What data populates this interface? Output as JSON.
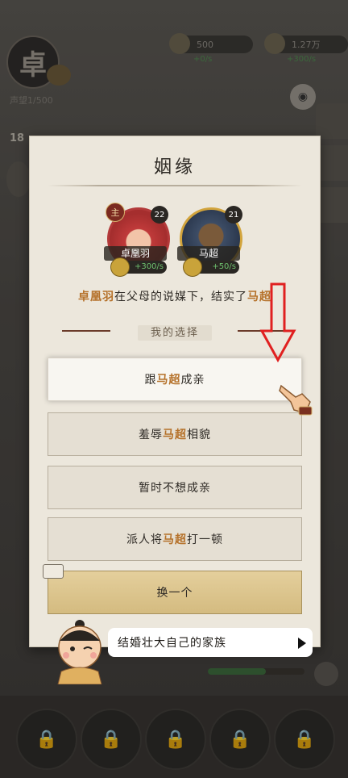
{
  "hud": {
    "player_char": "卓",
    "reputation": "声望1/500",
    "copper": "500",
    "copper_rate": "+0/s",
    "silver": "1.27万",
    "silver_rate": "+300/s",
    "level_num": "18"
  },
  "modal": {
    "title": "姻缘",
    "heroes": [
      {
        "name": "卓凰羽",
        "level": "22",
        "bonus": "+300/s",
        "tag": "主"
      },
      {
        "name": "马超",
        "level": "21",
        "bonus": "+50/s"
      }
    ],
    "story": {
      "a": "卓凰羽",
      "b": "在父母的说媒下，结实了",
      "c": "马超"
    },
    "section_label": "我的选择",
    "choices": [
      {
        "pre": "跟",
        "hl": "马超",
        "post": "成亲"
      },
      {
        "pre": "羞辱",
        "hl": "马超",
        "post": "相貌"
      },
      {
        "pre": "暂时不想成亲",
        "hl": "",
        "post": ""
      },
      {
        "pre": "派人将",
        "hl": "马超",
        "post": "打一顿"
      }
    ],
    "swap_label": "换一个"
  },
  "advisor": {
    "tip": "结婚壮大自己的家族"
  },
  "colors": {
    "highlight": "#b5712a",
    "arrow": "#e02020",
    "swap_bg": "#d9c288"
  },
  "icons": [
    "eye-icon",
    "video-icon",
    "play-icon",
    "lock-icon",
    "down-arrow-icon",
    "pointing-hand-icon",
    "coin-icon"
  ]
}
